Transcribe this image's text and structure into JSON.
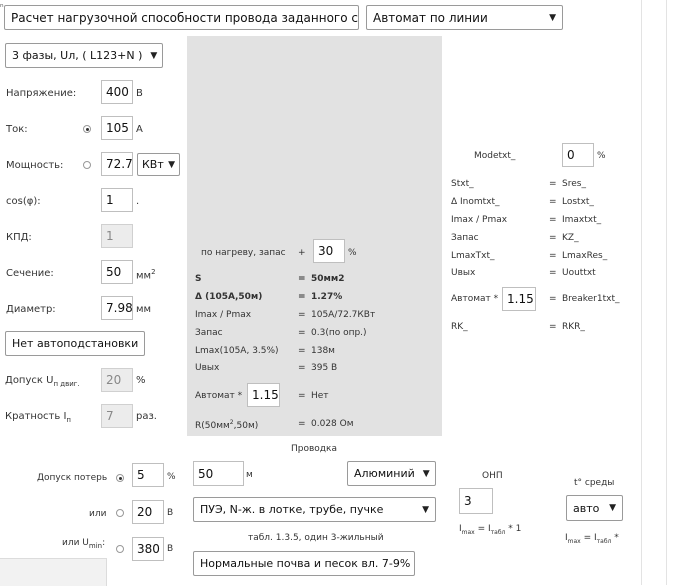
{
  "top": {
    "calc_mode": "Расчет нагрузочной способности провода заданного сечения",
    "breaker_mode": "Автомат по линии"
  },
  "left": {
    "phase": "3 фазы, Uл,  ( L123+N )",
    "voltage_label": "Напряжение:",
    "voltage_value": "400",
    "voltage_unit": "В",
    "current_label": "Ток:",
    "current_value": "105",
    "current_unit": "А",
    "power_label": "Мощность:",
    "power_value": "72.7",
    "power_unit": "КВт",
    "cos_label": "cos(φ):",
    "cos_value": "1",
    "cos_unit": ".",
    "kpd_label": "КПД:",
    "kpd_value": "1",
    "section_label": "Сечение:",
    "section_value": "50",
    "section_unit": "мм",
    "diameter_label": "Диаметр:",
    "diameter_value": "7.98",
    "diameter_unit": "мм",
    "autosub": "Нет автоподстановки",
    "tol_label": "Допуск U",
    "tol_sub": "п двиг.",
    "tol_value": "20",
    "tol_unit": "%",
    "mult_label": "Кратность I",
    "mult_sub": "п",
    "mult_value": "7",
    "mult_unit": "раз."
  },
  "results": {
    "heat_label": "по нагреву, запас",
    "heat_plus": "+",
    "heat_value": "30",
    "heat_unit": "%",
    "rows": [
      {
        "k": "S",
        "v": "50мм2",
        "bold": true
      },
      {
        "k": "Δ (105А,50м)",
        "v": "1.27%",
        "bold": true
      },
      {
        "k": "Imax / Pmax",
        "v": "105А/72.7КВт",
        "bold": false
      },
      {
        "k": "Запас",
        "v": "0.3(по опр.)",
        "bold": false
      },
      {
        "k": "Lmax(105А, 3.5%)",
        "v": "138м",
        "bold": false
      },
      {
        "k": "Uвых",
        "v": "395 В",
        "bold": false
      }
    ],
    "eq": "=",
    "breaker_label": "Автомат *",
    "breaker_value": "1.15",
    "breaker_result": "Нет",
    "r_label": "R(50мм",
    "r_label2": ",50м)",
    "r_sup": "2",
    "r_value": "0.028 Ом"
  },
  "right": {
    "mode_label": "Modetxt_",
    "mode_value": "0",
    "mode_unit": "%",
    "rows": [
      {
        "k": "Stxt_",
        "v": "Sres_"
      },
      {
        "k": "Δ Inomtxt_",
        "v": "Lostxt_"
      },
      {
        "k": "Imax / Pmax",
        "v": "Imaxtxt_"
      },
      {
        "k": "Запас",
        "v": "KZ_"
      },
      {
        "k": "LmaxTxt_",
        "v": "LmaxRes_"
      },
      {
        "k": "Uвых",
        "v": "Uouttxt"
      }
    ],
    "breaker_label": "Автомат *",
    "breaker_value": "1.15",
    "breaker_result": "Breaker1txt_",
    "rk_label": "RK_",
    "rk_value": "RKR_"
  },
  "bottom": {
    "wiring_title": "Проводка",
    "loss_label": "Допуск потерь",
    "loss_value": "5",
    "loss_unit": "%",
    "or1_label": "или",
    "or1_value": "20",
    "or1_unit": "В",
    "or2_label": "или U",
    "or2_sub": "min",
    "or2_value": "380",
    "or2_unit": "В",
    "length_value": "50",
    "length_unit": "м",
    "material": "Алюминий",
    "method": "ПУЭ, N-ж. в лотке, трубе, пучке",
    "table_note": "табл. 1.3.5, один 3-жильный",
    "soil": "Нормальные почва и песок вл. 7-9%",
    "onp_label": "ОНП",
    "onp_value": "3",
    "imax1": "I",
    "imax1_sub1": "max",
    "imax1_mid": " = I",
    "imax1_sub2": "табл",
    "imax1_end": " * 1",
    "temp_label": "t° среды",
    "temp_value": "авто",
    "imax2": "I",
    "imax2_sub1": "max",
    "imax2_mid": " = I",
    "imax2_sub2": "табл",
    "imax2_end": " *"
  }
}
